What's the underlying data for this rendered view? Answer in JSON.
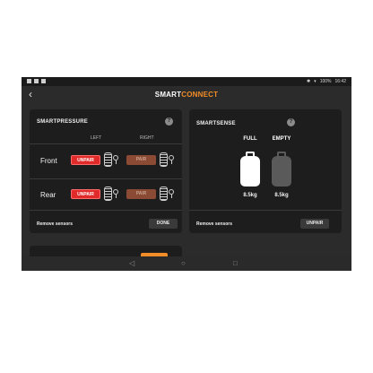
{
  "status_bar": {
    "bluetooth": "✱",
    "wifi": "▾",
    "battery": "100%",
    "time": "16:42"
  },
  "header": {
    "back_icon": "‹",
    "brand_part1": "SMART",
    "brand_part2": "CONNECT"
  },
  "smartpressure": {
    "title": "SMARTPRESSURE",
    "help": "?",
    "columns": {
      "left": "LEFT",
      "right": "RIGHT"
    },
    "rows": [
      {
        "label": "Front",
        "left_button": "UNPAIR",
        "right_button": "PAIR"
      },
      {
        "label": "Rear",
        "left_button": "UNPAIR",
        "right_button": "PAIR"
      }
    ],
    "remove_label": "Remove sensors",
    "done_button": "DONE"
  },
  "smartsense": {
    "title": "SMARTSENSE",
    "help": "?",
    "tanks": [
      {
        "label": "FULL",
        "weight": "8.5kg",
        "state": "full"
      },
      {
        "label": "EMPTY",
        "weight": "8.5kg",
        "state": "empty"
      }
    ],
    "remove_label": "Remove sensors",
    "unpair_button": "UNPAIR"
  },
  "nav": {
    "back": "◁",
    "home": "○",
    "recents": "□"
  },
  "colors": {
    "accent": "#f28c28",
    "unpair": "#e12a2a",
    "pair_disabled": "#8a4a34"
  }
}
